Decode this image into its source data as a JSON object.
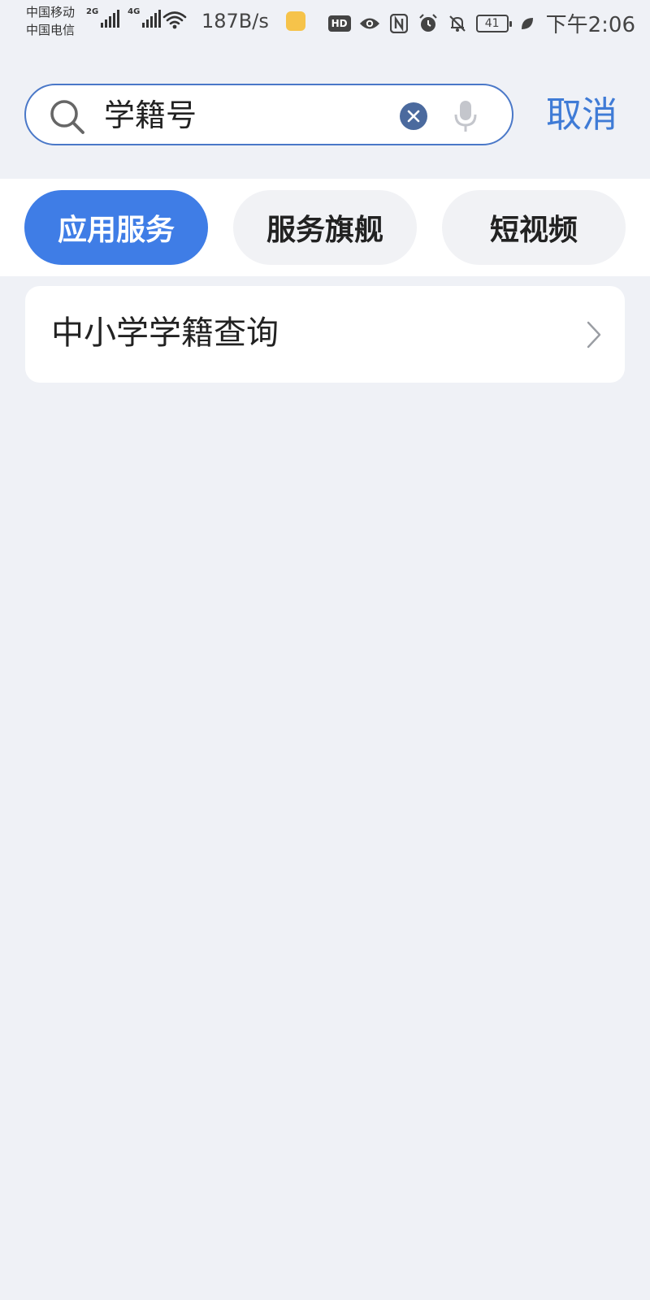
{
  "status_bar": {
    "carrier_1": "中国移动",
    "carrier_2": "中国电信",
    "signal_1_gen": "2G",
    "signal_2_gen": "4G",
    "net_speed": "187B/s",
    "hd_label": "HD",
    "battery_level": "41",
    "time": "下午2:06"
  },
  "search": {
    "query": "学籍号",
    "cancel_label": "取消",
    "accent_color": "#3f7bd6"
  },
  "tabs": [
    {
      "label": "应用服务",
      "active": true
    },
    {
      "label": "服务旗舰",
      "active": false
    },
    {
      "label": "短视频",
      "active": false
    }
  ],
  "results": [
    {
      "title": "中小学学籍查询"
    }
  ],
  "icons": {
    "search": "search-icon",
    "clear": "clear-icon",
    "mic": "mic-icon",
    "chevron": "chevron-right-icon"
  }
}
